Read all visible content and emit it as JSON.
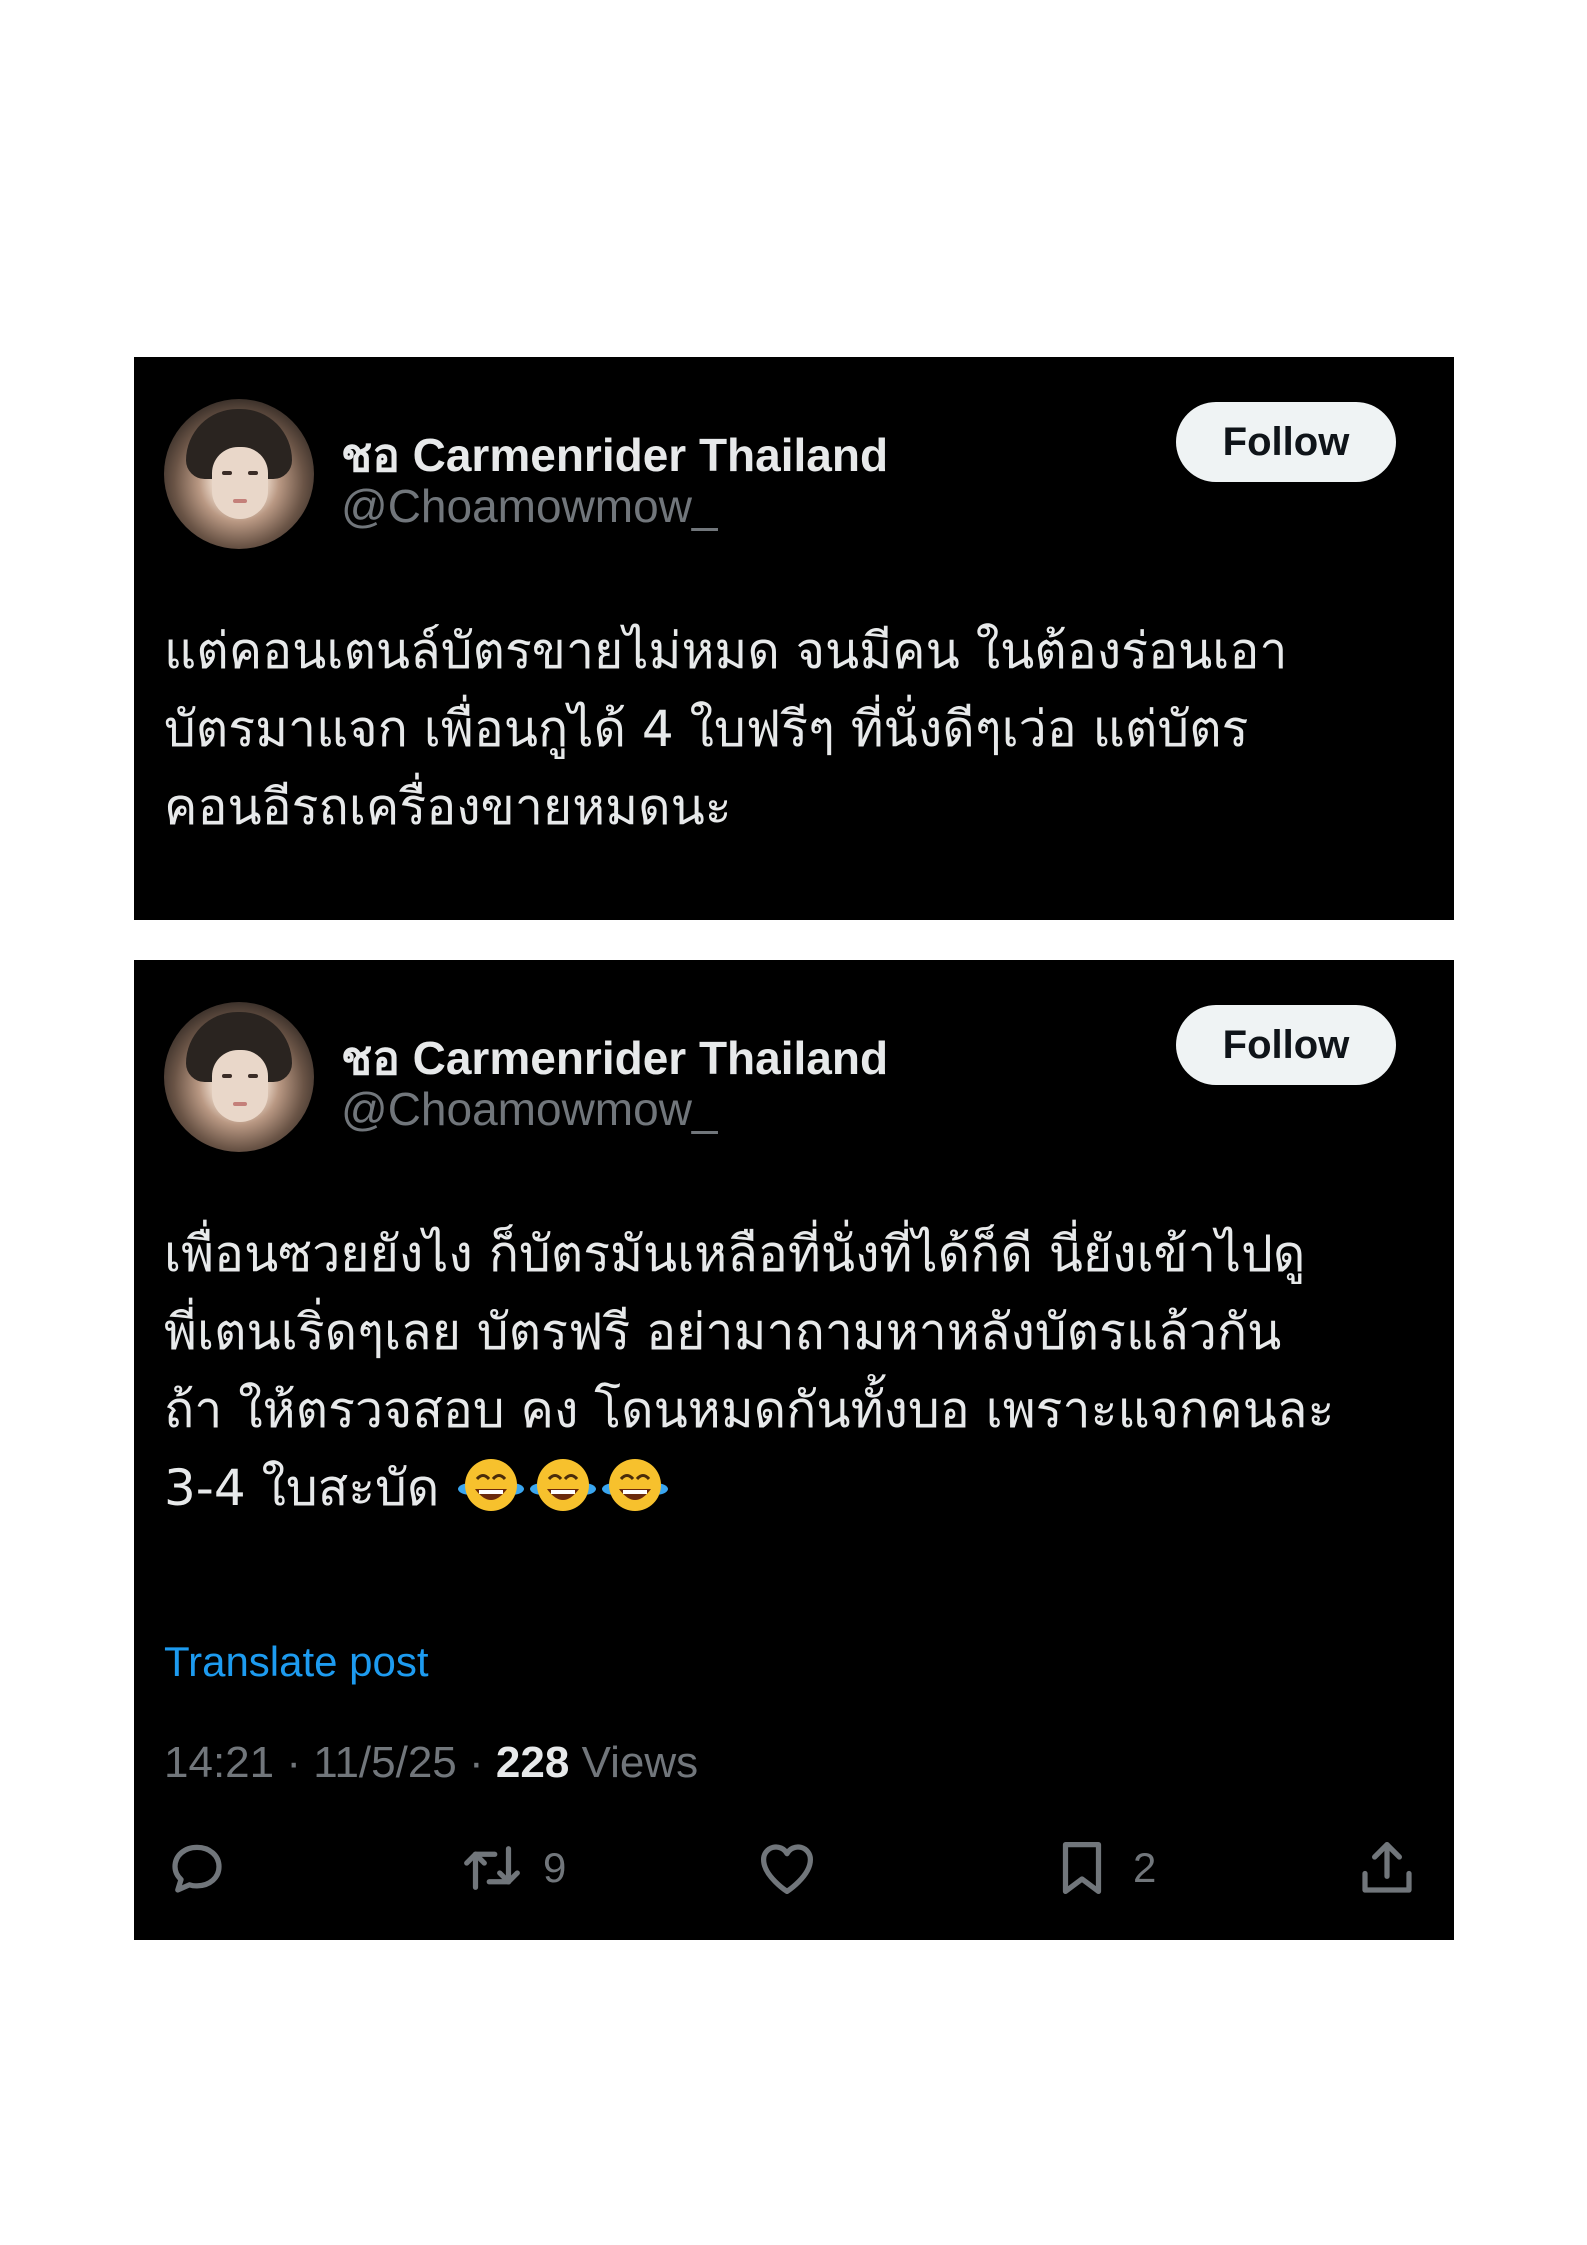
{
  "colors": {
    "card_background": "#000000",
    "text_primary": "#e7e9ea",
    "text_secondary": "#71767b",
    "link": "#1d9bf0",
    "follow_button_background": "#eff3f4"
  },
  "posts": [
    {
      "display_name": "ชอ Carmenrider Thailand",
      "handle": "@Choamowmow_",
      "follow_label": "Follow",
      "text_lines": [
        "แต่คอนเตนล์บัตรขายไม่หมด จนมีคน ในต้องร่อนเอา",
        "บัตรมาแจก เพื่อนกูได้ 4 ใบฟรีๆ ที่นั่งดีๆเว่อ แต่บัตร",
        "คอนอีรถเครื่องขายหมดนะ"
      ]
    },
    {
      "display_name": "ชอ Carmenrider Thailand",
      "handle": "@Choamowmow_",
      "follow_label": "Follow",
      "text_lines": [
        "เพื่อนซวยยังไง ก็บัตรมันเหลือที่นั่งที่ได้ก็ดี นี่ยังเข้าไปดู",
        "พี่เตนเริ่ดๆเลย บัตรฟรี อย่ามาถามหาหลังบัตรแล้วกัน",
        "ถ้า ให้ตรวจสอบ คง โดนหมดกันทั้งบอ เพราะแจกคนละ",
        "3-4 ใบสะบัด"
      ],
      "emoji": [
        "face-with-tears-of-joy",
        "face-with-tears-of-joy",
        "face-with-tears-of-joy"
      ],
      "translate_label": "Translate post",
      "time": "14:21",
      "date": "11/5/25",
      "separator": "·",
      "views_count": "228",
      "views_label": "Views",
      "actions": {
        "reply": {
          "icon": "reply-icon",
          "count": ""
        },
        "repost": {
          "icon": "repost-icon",
          "count": "9"
        },
        "like": {
          "icon": "heart-icon",
          "count": ""
        },
        "bookmark": {
          "icon": "bookmark-icon",
          "count": "2"
        },
        "share": {
          "icon": "share-icon",
          "count": ""
        }
      }
    }
  ]
}
